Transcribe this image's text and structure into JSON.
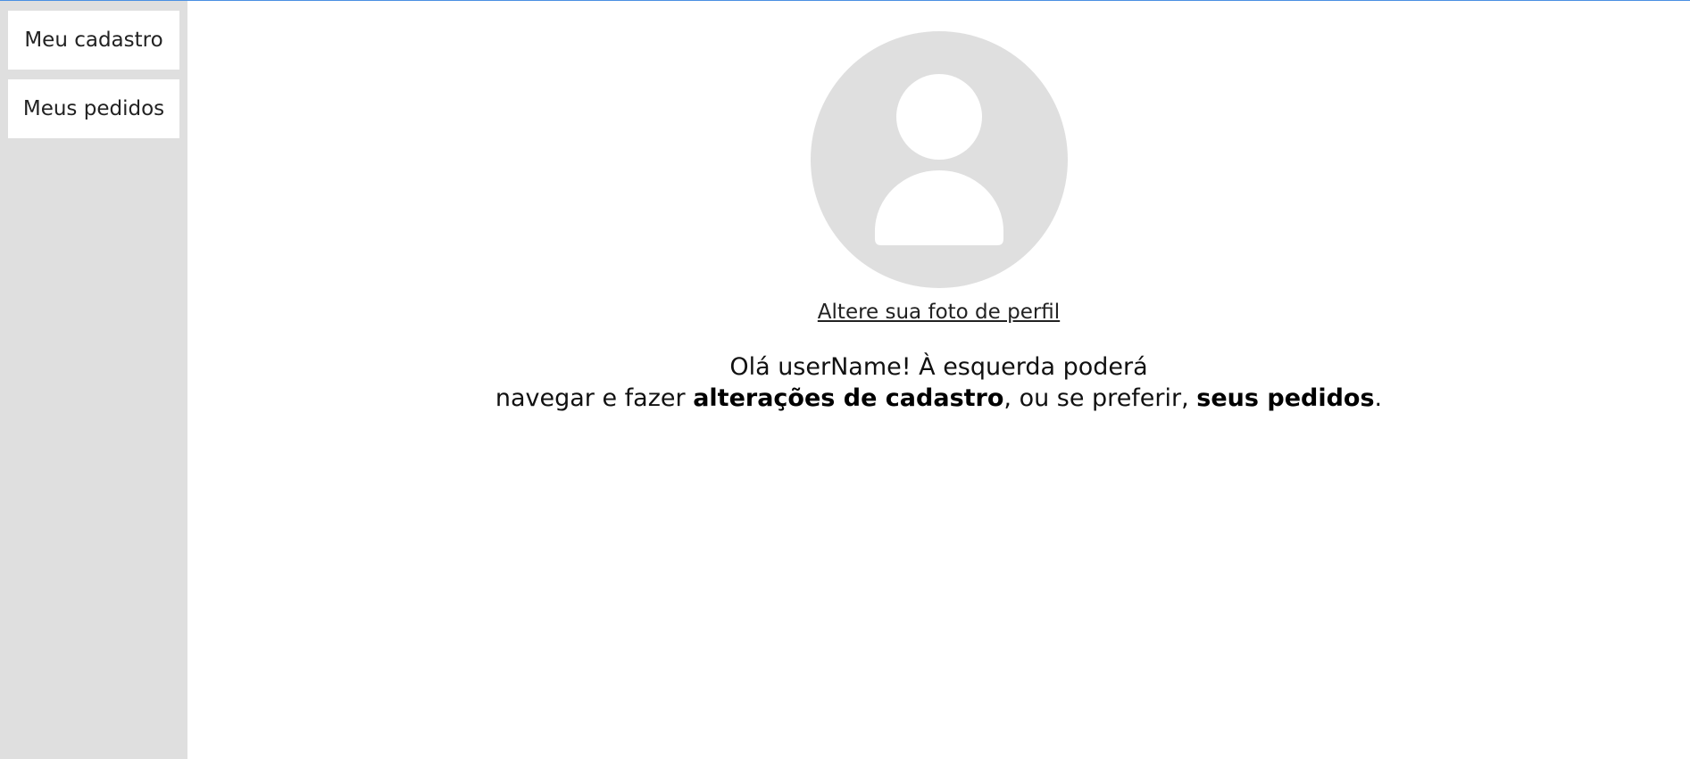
{
  "sidebar": {
    "items": [
      {
        "label": "Meu cadastro"
      },
      {
        "label": "Meus pedidos"
      }
    ]
  },
  "profile": {
    "avatar_icon": "user-avatar-placeholder-icon",
    "change_photo_label": "Altere sua foto de perfil"
  },
  "welcome": {
    "line1": "Olá userName! À esquerda poderá",
    "line2_prefix": "navegar e fazer ",
    "bold_registration": "alterações de cadastro",
    "line2_middle": ", ou se preferir, ",
    "bold_orders": "seus pedidos",
    "line2_suffix": "."
  },
  "colors": {
    "sidebar_background": "#dfdfdf",
    "avatar_background": "#dfdfdf",
    "accent_line": "#4a90e2"
  }
}
